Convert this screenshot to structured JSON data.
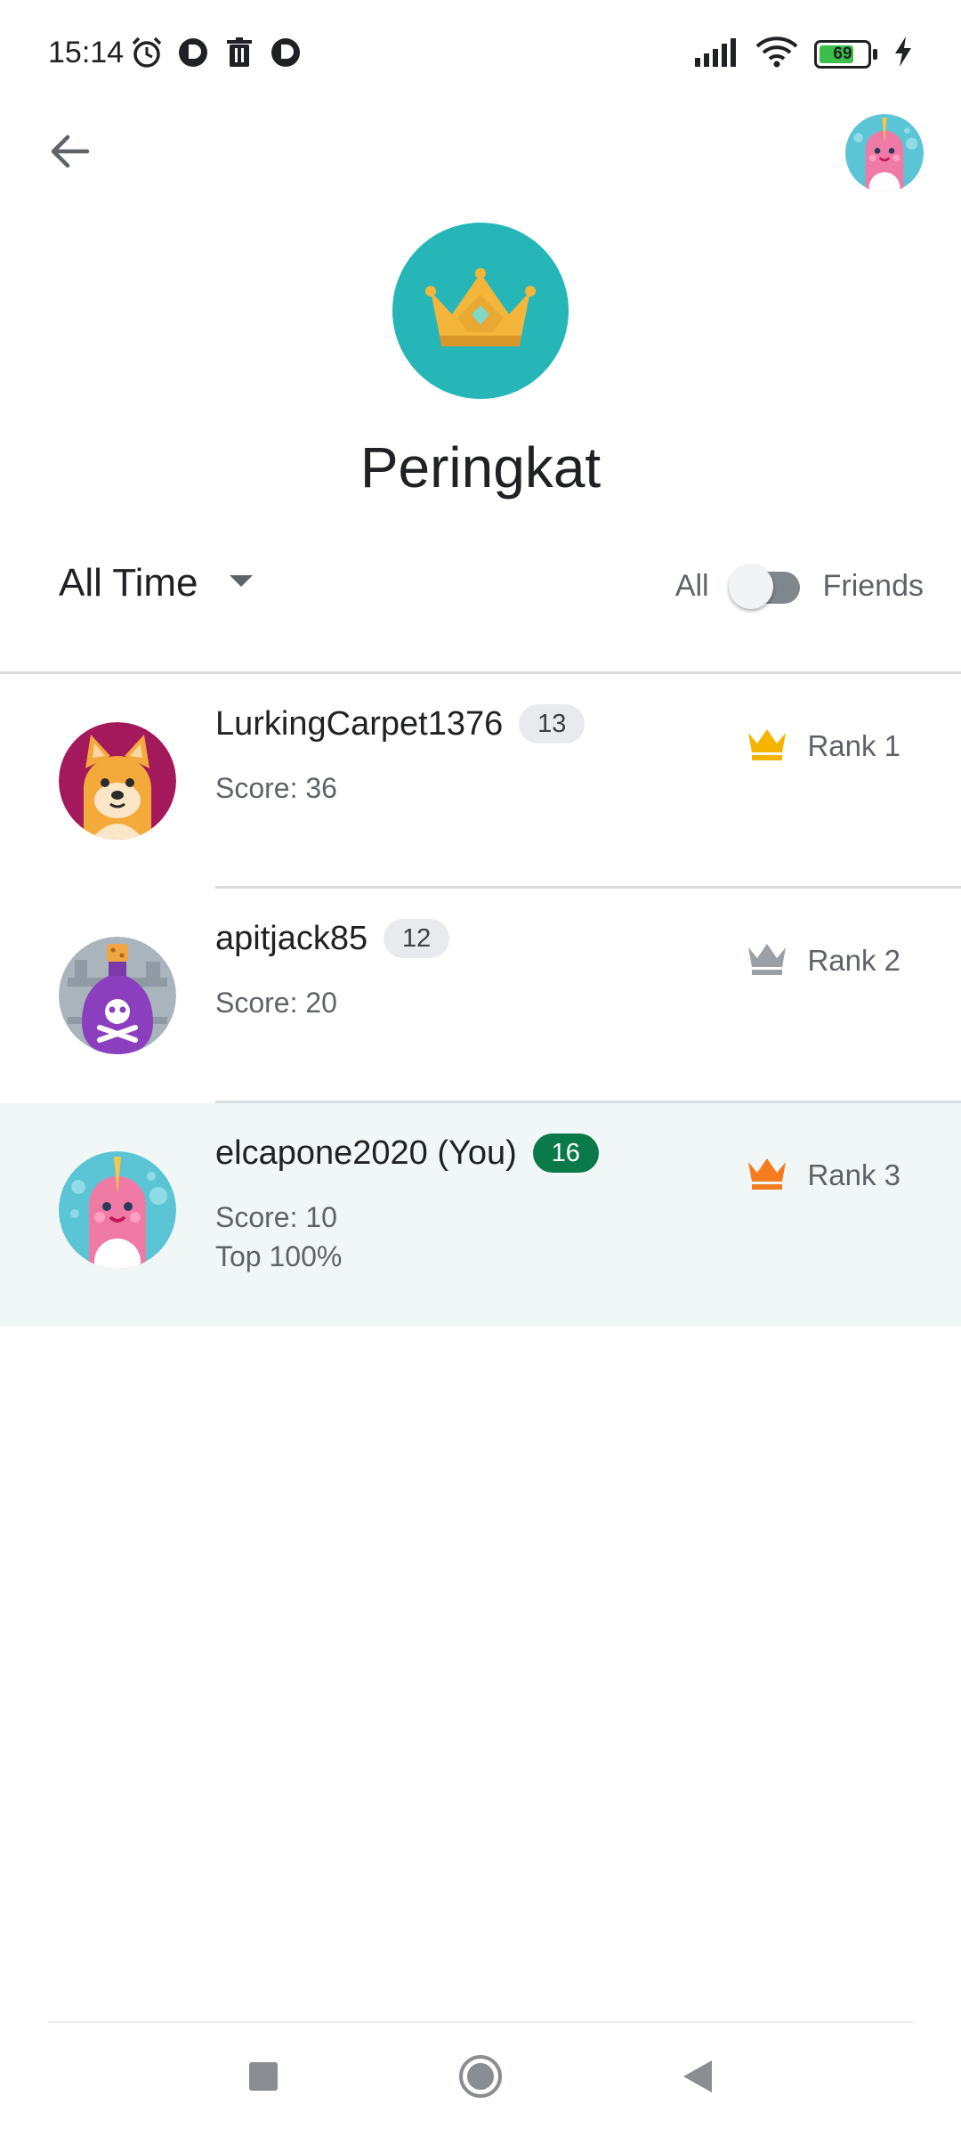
{
  "status_bar": {
    "time": "15:14",
    "battery_percent": "69",
    "left_icons": [
      "alarm-icon",
      "app-notification-icon",
      "trash-icon",
      "app-notification-icon"
    ],
    "right_icons": [
      "signal-icon",
      "wifi-icon",
      "battery-icon",
      "charging-icon"
    ]
  },
  "header": {
    "title": "Peringkat",
    "badge_icon": "crown-icon",
    "badge_color": "#26b6b8"
  },
  "filters": {
    "time_range": "All Time",
    "toggle_left_label": "All",
    "toggle_right_label": "Friends",
    "toggle_on": false
  },
  "leaderboard": [
    {
      "name": "LurkingCarpet1376",
      "level": "13",
      "score": "Score: 36",
      "rank": "Rank 1",
      "crown_color": "#f6b400",
      "avatar": "shiba-dog-avatar",
      "is_you": false
    },
    {
      "name": "apitjack85",
      "level": "12",
      "score": "Score: 20",
      "rank": "Rank 2",
      "crown_color": "#9aa0a6",
      "avatar": "poison-bottle-avatar",
      "is_you": false
    },
    {
      "name": "elcapone2020 (You)",
      "level": "16",
      "score": "Score: 10",
      "extra": "Top 100%",
      "rank": "Rank 3",
      "crown_color": "#f57c1f",
      "avatar": "narwhal-avatar",
      "is_you": true
    }
  ],
  "colors": {
    "accent_teal": "#26b6b8",
    "you_chip": "#0b7a4b",
    "highlight_row": "#f1f7f6"
  },
  "nav_bar": [
    "recents-square-icon",
    "home-circle-icon",
    "back-triangle-icon"
  ]
}
